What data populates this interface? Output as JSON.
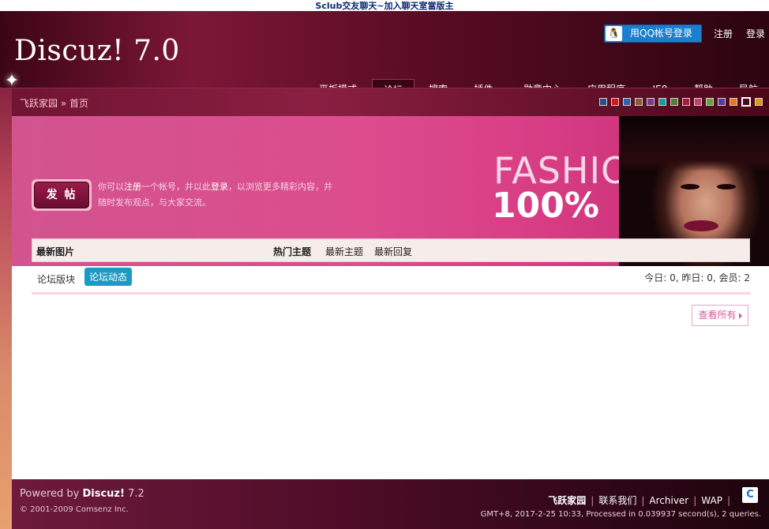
{
  "top_banner": {
    "text": "Sclub交友聊天~加入聊天室當版主"
  },
  "header": {
    "logo": "Discuz! 7.0",
    "qq_login": "用QQ帐号登录",
    "register": "注册",
    "login": "登录",
    "nav": [
      {
        "label": "平板模式"
      },
      {
        "label": "论坛"
      },
      {
        "label": "搜索"
      },
      {
        "label": "插件"
      },
      {
        "label": "勋章中心"
      },
      {
        "label": "应用程序"
      },
      {
        "label": "IE8"
      },
      {
        "label": "帮助"
      },
      {
        "label": "导航"
      }
    ]
  },
  "breadcrumb": {
    "site": "飞跃家园",
    "sep": "»",
    "page": "首页"
  },
  "swatches": [
    "#2a4f8a",
    "#d01818",
    "#3060b0",
    "#8a5a3a",
    "#7a3a8a",
    "#1a9a9a",
    "#5a7a3a",
    "#b01838",
    "#c04070",
    "#6aa03a",
    "#5a3a9a",
    "#e07a1a",
    "#ffffff",
    "#e8901a"
  ],
  "banner": {
    "fashion": "FASHION",
    "percent": "100%",
    "post_button": "发 帖",
    "intro_1": "你可以",
    "intro_register": "注册",
    "intro_2": "一个帐号，并以此",
    "intro_login": "登录",
    "intro_3": "，以浏览更多精彩内容，并随时发布观点，与大家交流。"
  },
  "tabs": {
    "latest_images": "最新图片",
    "hot_topics": "热门主题",
    "new_topics": "最新主题",
    "new_replies": "最新回复"
  },
  "content": {
    "forum_sections": "论坛版块",
    "forum_activity": "论坛动态",
    "stats": "今日: 0, 昨日: 0, 会员: 2",
    "view_all": "查看所有"
  },
  "footer": {
    "powered_prefix": "Powered by ",
    "powered_name": "Discuz!",
    "powered_version": " 7.2",
    "copyright": "© 2001-2009 Comsenz Inc.",
    "site": "飞跃家园",
    "contact": "联系我们",
    "archiver": "Archiver",
    "wap": "WAP",
    "time": "GMT+8, 2017-2-25 10:33, Processed in 0.039937 second(s), 2 queries."
  }
}
